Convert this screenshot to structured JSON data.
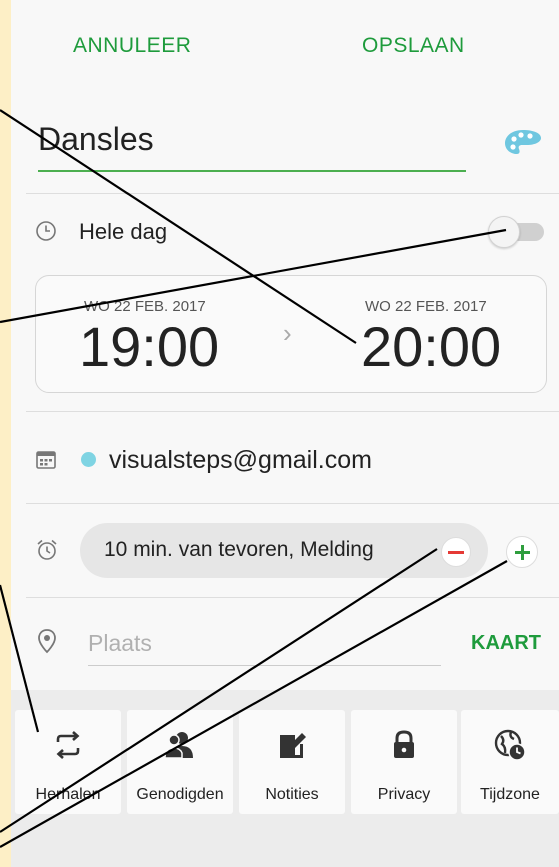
{
  "header": {
    "cancel_label": "ANNULEER",
    "save_label": "OPSLAAN"
  },
  "event": {
    "title": "Dansles"
  },
  "all_day": {
    "label": "Hele dag",
    "enabled": false
  },
  "start": {
    "date": "WO 22 FEB. 2017",
    "time": "19:00"
  },
  "end": {
    "date": "WO 22 FEB. 2017",
    "time": "20:00"
  },
  "calendar": {
    "account": "visualsteps@gmail.com",
    "color": "#7fd4e3"
  },
  "reminder": {
    "label": "10 min. van tevoren, Melding"
  },
  "location": {
    "placeholder": "Plaats",
    "map_label": "KAART"
  },
  "toolbar": {
    "items": [
      {
        "label": "Herhalen",
        "icon": "repeat-icon"
      },
      {
        "label": "Genodigden",
        "icon": "invitees-icon"
      },
      {
        "label": "Notities",
        "icon": "notes-icon"
      },
      {
        "label": "Privacy",
        "icon": "lock-icon"
      },
      {
        "label": "Tijdzone",
        "icon": "timezone-icon"
      }
    ]
  },
  "colors": {
    "accent": "#1e9b3c",
    "underline": "#4caf50",
    "minus": "#e53935"
  }
}
